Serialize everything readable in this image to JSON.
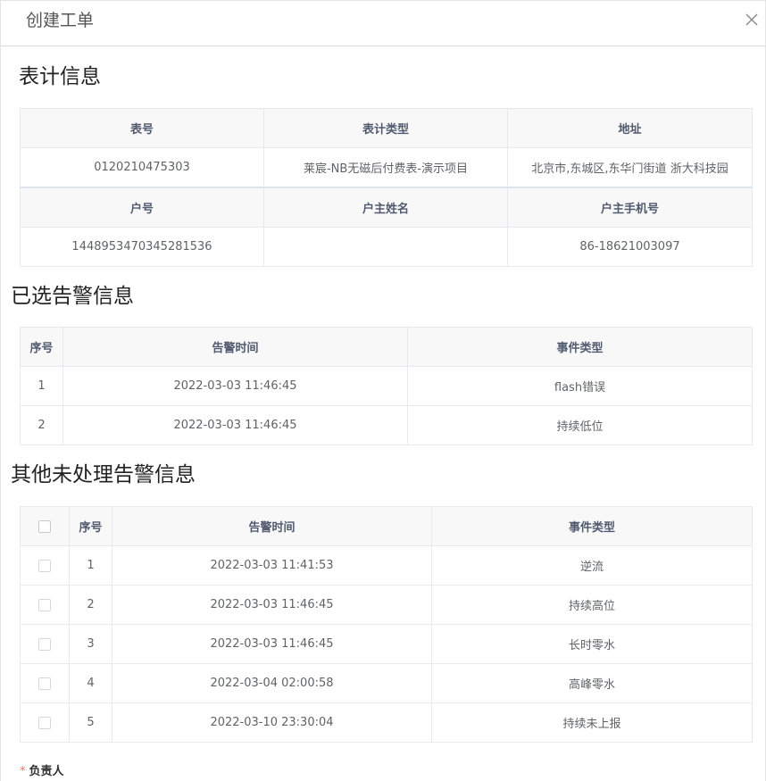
{
  "dialog": {
    "title": "创建工单",
    "close_icon": "close-icon"
  },
  "meter_info": {
    "title": "表计信息",
    "row1_headers": [
      "表号",
      "表计类型",
      "地址"
    ],
    "row1_values": [
      "0120210475303",
      "莱宸-NB无磁后付费表-演示项目",
      "北京市,东城区,东华门街道 浙大科技园"
    ],
    "row2_headers": [
      "户号",
      "户主姓名",
      "户主手机号"
    ],
    "row2_values": [
      "1448953470345281536",
      "",
      "86-18621003097"
    ]
  },
  "selected_alarms": {
    "title": "已选告警信息",
    "headers": [
      "序号",
      "告警时间",
      "事件类型"
    ],
    "rows": [
      [
        "1",
        "2022-03-03 11:46:45",
        "flash错误"
      ],
      [
        "2",
        "2022-03-03 11:46:45",
        "持续低位"
      ]
    ]
  },
  "other_alarms": {
    "title": "其他未处理告警信息",
    "headers": [
      "",
      "序号",
      "告警时间",
      "事件类型"
    ],
    "rows": [
      [
        "",
        "1",
        "2022-03-03 11:41:53",
        "逆流"
      ],
      [
        "",
        "2",
        "2022-03-03 11:46:45",
        "持续高位"
      ],
      [
        "",
        "3",
        "2022-03-03 11:46:45",
        "长时零水"
      ],
      [
        "",
        "4",
        "2022-03-04 02:00:58",
        "高峰零水"
      ],
      [
        "",
        "5",
        "2022-03-10 23:30:04",
        "持续未上报"
      ]
    ]
  },
  "form": {
    "required_mark": "*",
    "owner_label": "负责人"
  }
}
